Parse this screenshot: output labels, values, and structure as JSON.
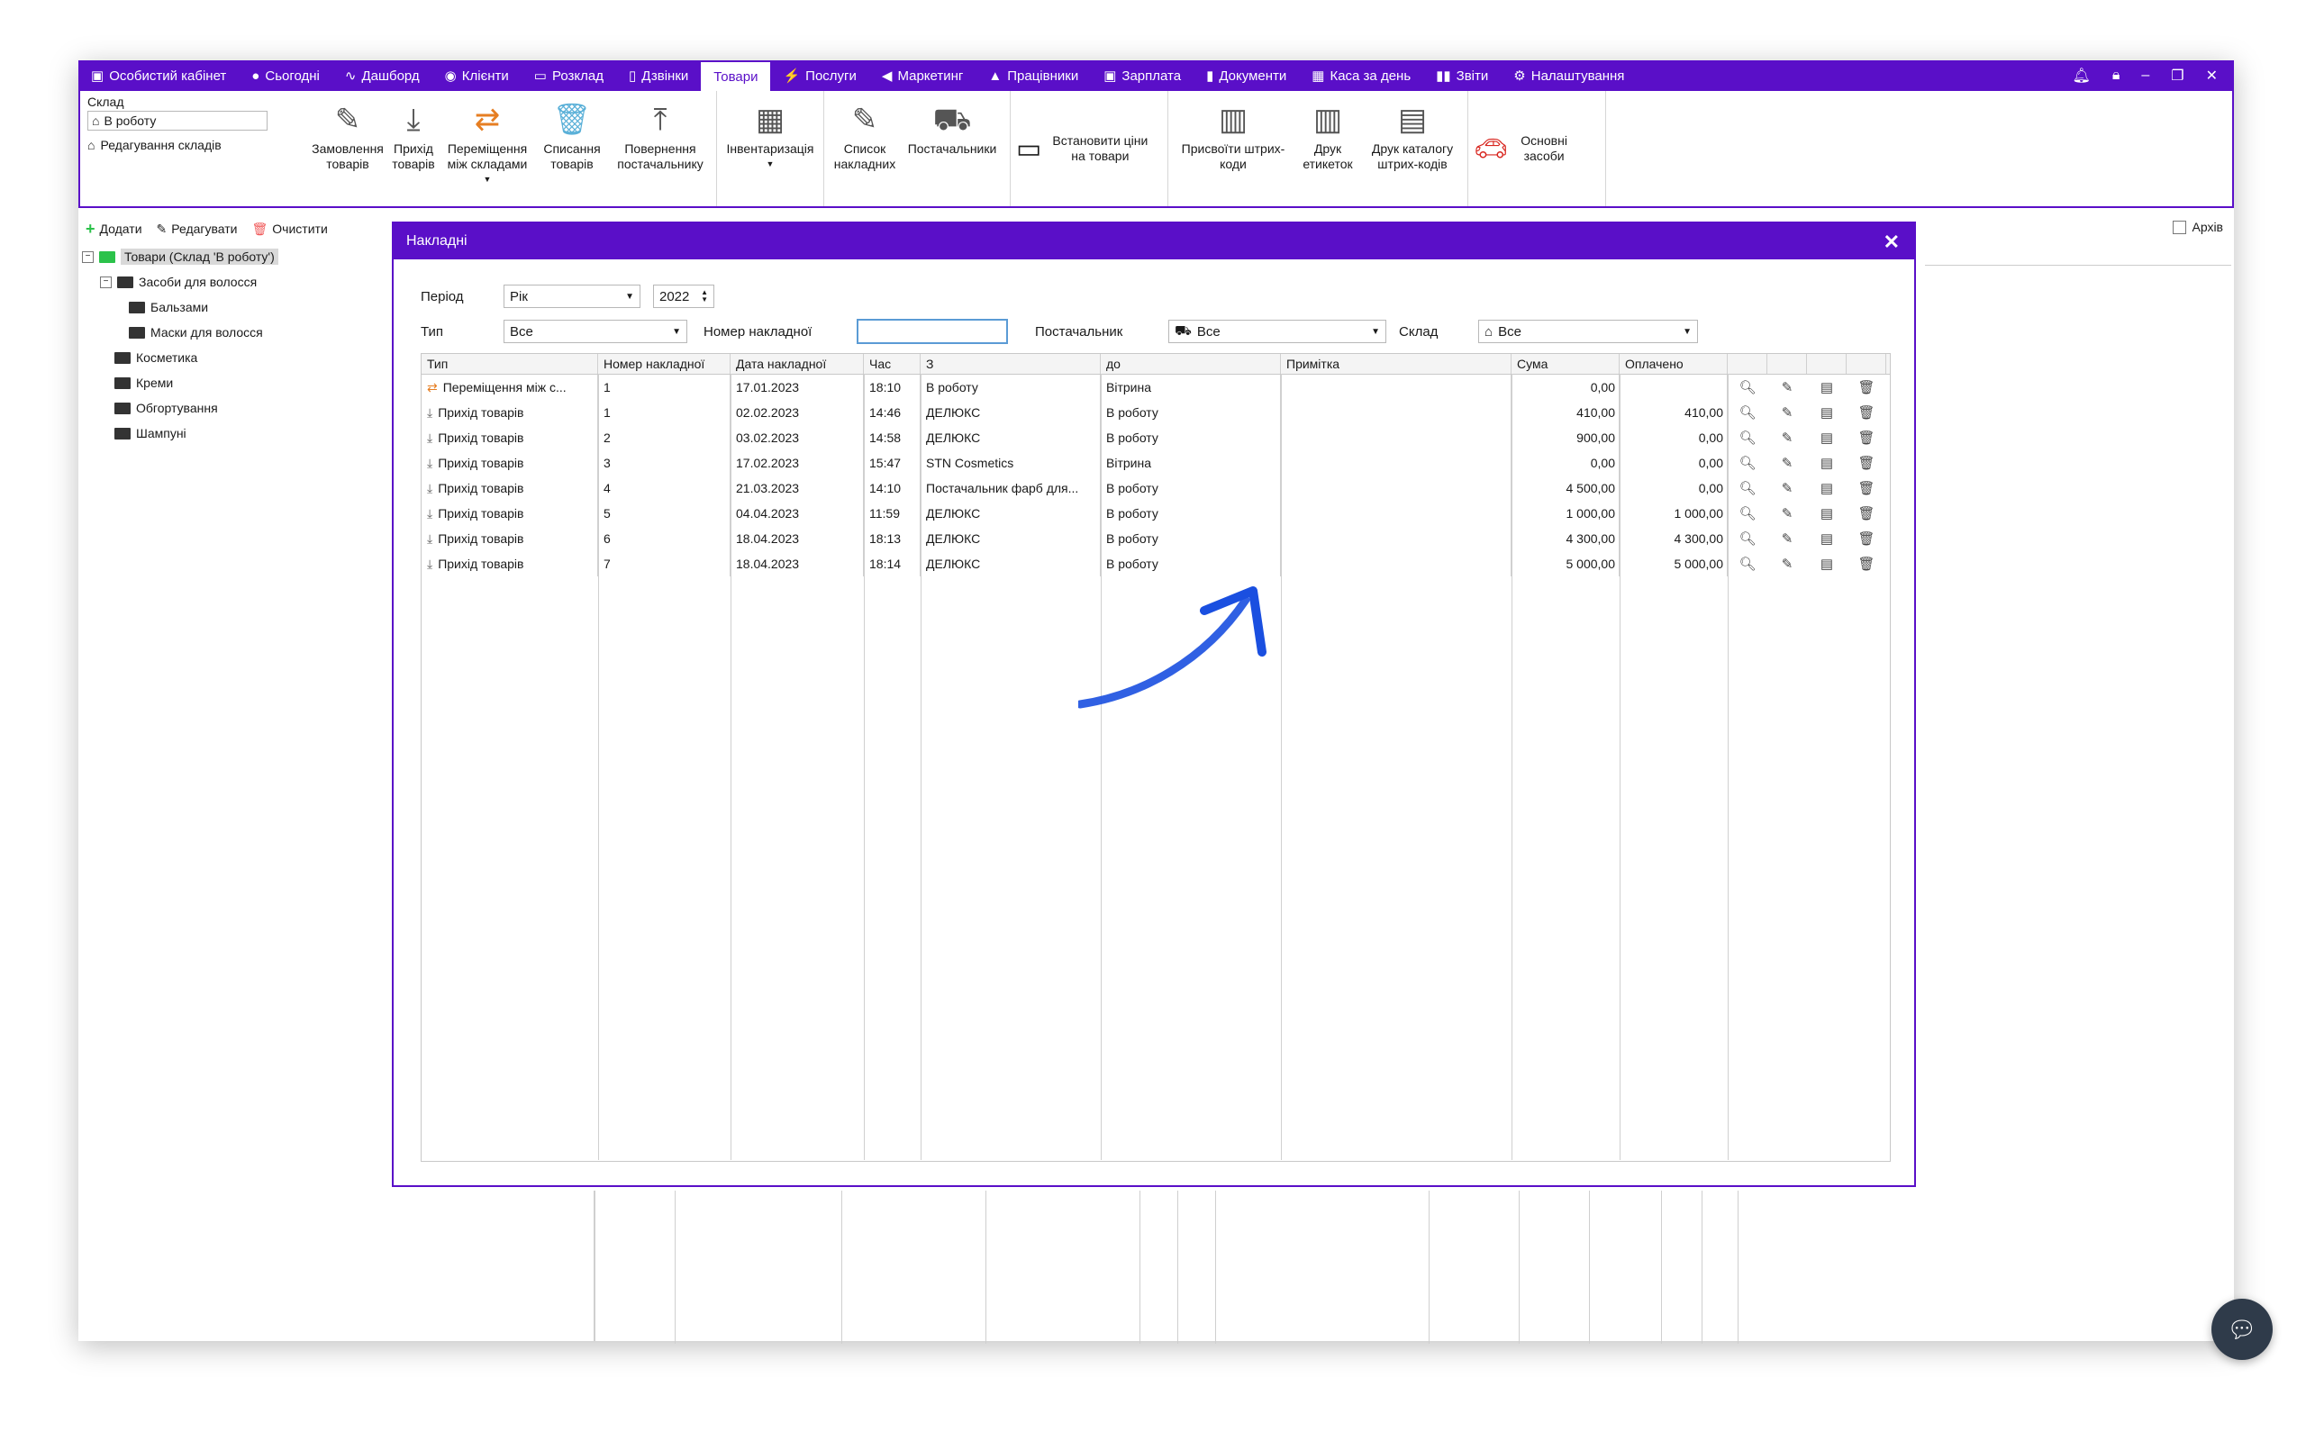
{
  "topnav": {
    "tabs": [
      {
        "label": "Особистий кабінет",
        "icon": "briefcase-icon"
      },
      {
        "label": "Сьогодні",
        "icon": "circle-icon"
      },
      {
        "label": "Дашборд",
        "icon": "pulse-icon"
      },
      {
        "label": "Клієнти",
        "icon": "user-circle-icon"
      },
      {
        "label": "Розклад",
        "icon": "calendar-icon"
      },
      {
        "label": "Дзвінки",
        "icon": "phone-icon"
      },
      {
        "label": "Товари",
        "icon": "",
        "active": true
      },
      {
        "label": "Послуги",
        "icon": "lightning-icon"
      },
      {
        "label": "Маркетинг",
        "icon": "megaphone-icon"
      },
      {
        "label": "Працівники",
        "icon": "person-icon"
      },
      {
        "label": "Зарплата",
        "icon": "money-icon"
      },
      {
        "label": "Документи",
        "icon": "document-icon"
      },
      {
        "label": "Каса за день",
        "icon": "calculator-icon"
      },
      {
        "label": "Звіти",
        "icon": "bar-chart-icon"
      },
      {
        "label": "Налаштування",
        "icon": "gear-icon"
      }
    ]
  },
  "ribbon": {
    "sklad_label": "Склад",
    "sklad_value": "В роботу",
    "edit_warehouses": "Редагування складів",
    "buttons": [
      "Замовлення товарів",
      "Прихід товарів",
      "Переміщення між складами",
      "Списання товарів",
      "Повернення постачальнику",
      "Інвентаризація",
      "Список накладних",
      "Постачальники",
      "Встановити ціни на товари",
      "Присвоїти штрих-коди",
      "Друк етикеток",
      "Друк каталогу штрих-кодів",
      "Основні засоби"
    ]
  },
  "lefttool": {
    "add": "Додати",
    "edit": "Редагувати",
    "clear": "Очистити"
  },
  "archive_label": "Архів",
  "tree": {
    "root": "Товари (Склад 'В роботу')",
    "group": "Засоби для волосся",
    "children": [
      "Бальзами",
      "Маски для волосся"
    ],
    "others": [
      "Косметика",
      "Креми",
      "Обгортування",
      "Шампуні"
    ]
  },
  "modal": {
    "title": "Накладні",
    "period_label": "Період",
    "period_value": "Рік",
    "year_value": "2022",
    "type_label": "Тип",
    "type_value": "Все",
    "number_label": "Номер накладної",
    "number_value": "",
    "supplier_label": "Постачальник",
    "supplier_value": "Все",
    "warehouse_label": "Склад",
    "warehouse_value": "Все"
  },
  "grid": {
    "columns": [
      "Тип",
      "Номер накладної",
      "Дата накладної",
      "Час",
      "З",
      "до",
      "Примітка",
      "Сума",
      "Оплачено"
    ],
    "rows": [
      {
        "type": "Переміщення між с...",
        "num": "1",
        "date": "17.01.2023",
        "time": "18:10",
        "from": "В роботу",
        "to": "Вітрина",
        "note": "",
        "sum": "0,00",
        "paid": ""
      },
      {
        "type": "Прихід товарів",
        "num": "1",
        "date": "02.02.2023",
        "time": "14:46",
        "from": "ДЕЛЮКС",
        "to": "В роботу",
        "note": "",
        "sum": "410,00",
        "paid": "410,00"
      },
      {
        "type": "Прихід товарів",
        "num": "2",
        "date": "03.02.2023",
        "time": "14:58",
        "from": "ДЕЛЮКС",
        "to": "В роботу",
        "note": "",
        "sum": "900,00",
        "paid": "0,00"
      },
      {
        "type": "Прихід товарів",
        "num": "3",
        "date": "17.02.2023",
        "time": "15:47",
        "from": "STN Cosmetics",
        "to": "Вітрина",
        "note": "",
        "sum": "0,00",
        "paid": "0,00"
      },
      {
        "type": "Прихід товарів",
        "num": "4",
        "date": "21.03.2023",
        "time": "14:10",
        "from": "Постачальник фарб для...",
        "to": "В роботу",
        "note": "",
        "sum": "4 500,00",
        "paid": "0,00"
      },
      {
        "type": "Прихід товарів",
        "num": "5",
        "date": "04.04.2023",
        "time": "11:59",
        "from": "ДЕЛЮКС",
        "to": "В роботу",
        "note": "",
        "sum": "1 000,00",
        "paid": "1 000,00"
      },
      {
        "type": "Прихід товарів",
        "num": "6",
        "date": "18.04.2023",
        "time": "18:13",
        "from": "ДЕЛЮКС",
        "to": "В роботу",
        "note": "",
        "sum": "4 300,00",
        "paid": "4 300,00"
      },
      {
        "type": "Прихід товарів",
        "num": "7",
        "date": "18.04.2023",
        "time": "18:14",
        "from": "ДЕЛЮКС",
        "to": "В роботу",
        "note": "",
        "sum": "5 000,00",
        "paid": "5 000,00"
      }
    ]
  },
  "colors": {
    "accent": "#5a0fc8",
    "arrow": "#1a4fe0",
    "trash": "#f05a5a"
  }
}
